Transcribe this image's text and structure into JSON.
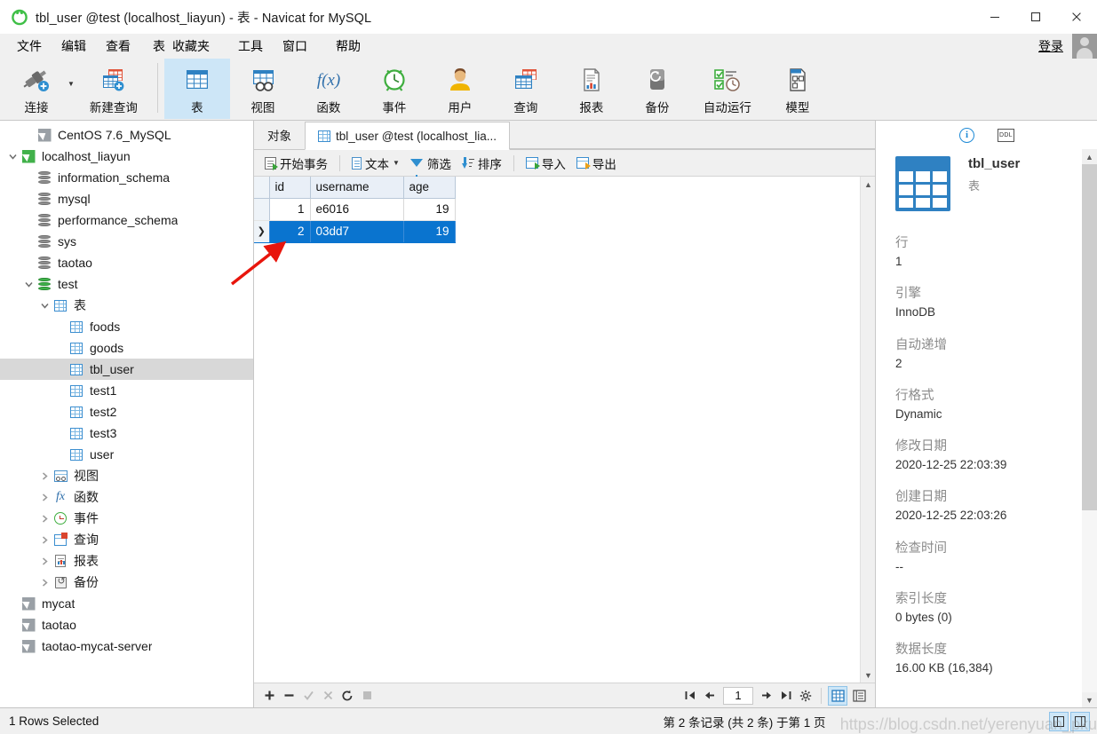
{
  "window": {
    "title": "tbl_user @test (localhost_liayun) - 表 - Navicat for MySQL",
    "logo_icon": "navicat-leaf-logo",
    "minimize_label": "—",
    "maximize_label": "❐",
    "close_label": "✕"
  },
  "menubar": {
    "items": [
      {
        "label": "文件",
        "name": "menu-file"
      },
      {
        "label": "编辑",
        "name": "menu-edit"
      },
      {
        "label": "查看",
        "name": "menu-view"
      },
      {
        "label": "表",
        "name": "menu-table"
      },
      {
        "label": "收藏夹",
        "name": "menu-favorites"
      },
      {
        "label": "工具",
        "name": "menu-tools"
      },
      {
        "label": "窗口",
        "name": "menu-window"
      },
      {
        "label": "帮助",
        "name": "menu-help"
      }
    ],
    "login_label": "登录",
    "avatar_icon": "user-avatar-icon"
  },
  "toolbar": {
    "items": [
      {
        "label": "连接",
        "icon": "connection-icon",
        "active": false
      },
      {
        "label": "新建查询",
        "icon": "new-query-icon",
        "active": false
      },
      {
        "label": "表",
        "icon": "table-icon",
        "active": true
      },
      {
        "label": "视图",
        "icon": "view-icon",
        "active": false
      },
      {
        "label": "函数",
        "icon": "function-fx-icon",
        "active": false
      },
      {
        "label": "事件",
        "icon": "event-clock-icon",
        "active": false
      },
      {
        "label": "用户",
        "icon": "user-icon",
        "active": false
      },
      {
        "label": "查询",
        "icon": "query-icon",
        "active": false
      },
      {
        "label": "报表",
        "icon": "report-icon",
        "active": false
      },
      {
        "label": "备份",
        "icon": "backup-icon",
        "active": false
      },
      {
        "label": "自动运行",
        "icon": "automation-icon",
        "active": false
      },
      {
        "label": "模型",
        "icon": "model-icon",
        "active": false
      }
    ]
  },
  "sidebar": {
    "nodes": [
      {
        "label": "CentOS 7.6_MySQL",
        "indent": 1,
        "icon": "connection-gray-icon",
        "twisty": "",
        "selected": false
      },
      {
        "label": "localhost_liayun",
        "indent": 0,
        "icon": "connection-green-icon",
        "twisty": "v",
        "selected": false
      },
      {
        "label": "information_schema",
        "indent": 1,
        "icon": "database-icon",
        "twisty": "",
        "selected": false
      },
      {
        "label": "mysql",
        "indent": 1,
        "icon": "database-icon",
        "twisty": "",
        "selected": false
      },
      {
        "label": "performance_schema",
        "indent": 1,
        "icon": "database-icon",
        "twisty": "",
        "selected": false
      },
      {
        "label": "sys",
        "indent": 1,
        "icon": "database-icon",
        "twisty": "",
        "selected": false
      },
      {
        "label": "taotao",
        "indent": 1,
        "icon": "database-icon",
        "twisty": "",
        "selected": false
      },
      {
        "label": "test",
        "indent": 1,
        "icon": "database-green-icon",
        "twisty": "v",
        "selected": false
      },
      {
        "label": "表",
        "indent": 2,
        "icon": "table-folder-icon",
        "twisty": "v",
        "selected": false
      },
      {
        "label": "foods",
        "indent": 3,
        "icon": "table-icon",
        "twisty": "",
        "selected": false
      },
      {
        "label": "goods",
        "indent": 3,
        "icon": "table-icon",
        "twisty": "",
        "selected": false
      },
      {
        "label": "tbl_user",
        "indent": 3,
        "icon": "table-icon",
        "twisty": "",
        "selected": true
      },
      {
        "label": "test1",
        "indent": 3,
        "icon": "table-icon",
        "twisty": "",
        "selected": false
      },
      {
        "label": "test2",
        "indent": 3,
        "icon": "table-icon",
        "twisty": "",
        "selected": false
      },
      {
        "label": "test3",
        "indent": 3,
        "icon": "table-icon",
        "twisty": "",
        "selected": false
      },
      {
        "label": "user",
        "indent": 3,
        "icon": "table-icon",
        "twisty": "",
        "selected": false
      },
      {
        "label": "视图",
        "indent": 2,
        "icon": "view-icon",
        "twisty": ">",
        "selected": false
      },
      {
        "label": "函数",
        "indent": 2,
        "icon": "function-fx-icon",
        "twisty": ">",
        "selected": false
      },
      {
        "label": "事件",
        "indent": 2,
        "icon": "event-clock-icon",
        "twisty": ">",
        "selected": false
      },
      {
        "label": "查询",
        "indent": 2,
        "icon": "query-icon",
        "twisty": ">",
        "selected": false
      },
      {
        "label": "报表",
        "indent": 2,
        "icon": "report-icon",
        "twisty": ">",
        "selected": false
      },
      {
        "label": "备份",
        "indent": 2,
        "icon": "backup-icon",
        "twisty": ">",
        "selected": false
      },
      {
        "label": "mycat",
        "indent": 0,
        "icon": "connection-gray-icon",
        "twisty": "",
        "selected": false
      },
      {
        "label": "taotao",
        "indent": 0,
        "icon": "connection-gray-icon",
        "twisty": "",
        "selected": false
      },
      {
        "label": "taotao-mycat-server",
        "indent": 0,
        "icon": "connection-gray-icon",
        "twisty": "",
        "selected": false
      }
    ]
  },
  "tabs": {
    "items": [
      {
        "label": "对象",
        "icon": "",
        "active": false
      },
      {
        "label": "tbl_user @test (localhost_lia...",
        "icon": "table-icon",
        "active": true
      }
    ]
  },
  "gridbar": {
    "items": [
      {
        "label": "开始事务",
        "icon": "begin-transaction-icon",
        "caret": false
      },
      {
        "label": "文本",
        "icon": "text-icon",
        "caret": true
      },
      {
        "label": "筛选",
        "icon": "filter-icon",
        "caret": false
      },
      {
        "label": "排序",
        "icon": "sort-icon",
        "caret": false
      },
      {
        "label": "导入",
        "icon": "import-icon",
        "caret": false
      },
      {
        "label": "导出",
        "icon": "export-icon",
        "caret": false
      }
    ]
  },
  "grid": {
    "columns": [
      "id",
      "username",
      "age"
    ],
    "rows": [
      {
        "marker": "",
        "id": "1",
        "username": "e6016",
        "age": "19",
        "selected": false
      },
      {
        "marker": "❯",
        "id": "2",
        "username": "03dd7",
        "age": "19",
        "selected": true
      }
    ],
    "selection_color": "#0a74cf"
  },
  "gridfoot": {
    "left_buttons": [
      {
        "icon": "add-record-icon",
        "glyph": "✚",
        "disabled": false
      },
      {
        "icon": "delete-record-icon",
        "glyph": "▬",
        "disabled": false
      },
      {
        "icon": "apply-change-icon",
        "glyph": "✓",
        "disabled": true
      },
      {
        "icon": "cancel-change-icon",
        "glyph": "✕",
        "disabled": true
      },
      {
        "icon": "refresh-icon",
        "glyph": "⟳",
        "disabled": false
      },
      {
        "icon": "stop-icon",
        "glyph": "■",
        "disabled": true
      }
    ],
    "nav_buttons": [
      {
        "icon": "first-page-icon",
        "glyph": "⇤"
      },
      {
        "icon": "prev-page-icon",
        "glyph": "←"
      }
    ],
    "page_value": "1",
    "nav_buttons_after": [
      {
        "icon": "next-page-icon",
        "glyph": "→"
      },
      {
        "icon": "last-page-icon",
        "glyph": "⇥"
      },
      {
        "icon": "settings-gear-icon",
        "glyph": "⚙"
      }
    ],
    "view_toggles": [
      {
        "icon": "grid-view-icon",
        "active": true
      },
      {
        "icon": "form-view-icon",
        "active": false
      }
    ]
  },
  "infopanel": {
    "tabs": [
      {
        "icon": "info-icon",
        "active": true
      },
      {
        "icon": "ddl-icon",
        "active": false
      }
    ],
    "object_name": "tbl_user",
    "object_type": "表",
    "object_icon": "table-large-icon",
    "fields": [
      {
        "key": "行",
        "value": "1"
      },
      {
        "key": "引擎",
        "value": "InnoDB"
      },
      {
        "key": "自动递增",
        "value": "2"
      },
      {
        "key": "行格式",
        "value": "Dynamic"
      },
      {
        "key": "修改日期",
        "value": "2020-12-25 22:03:39"
      },
      {
        "key": "创建日期",
        "value": "2020-12-25 22:03:26"
      },
      {
        "key": "检查时间",
        "value": "--"
      },
      {
        "key": "索引长度",
        "value": "0 bytes (0)"
      },
      {
        "key": "数据长度",
        "value": "16.00 KB (16,384)"
      }
    ]
  },
  "statusbar": {
    "left": "1 Rows Selected",
    "middle": "第 2 条记录 (共 2 条) 于第 1 页",
    "toggles": [
      {
        "icon": "toggle-left-panel-icon",
        "active": true
      },
      {
        "icon": "toggle-right-panel-icon",
        "active": true
      }
    ]
  },
  "annotation": {
    "arrow_color": "#e8150c"
  },
  "watermark": {
    "text": "https://blog.csdn.net/yerenyuan_pku"
  }
}
